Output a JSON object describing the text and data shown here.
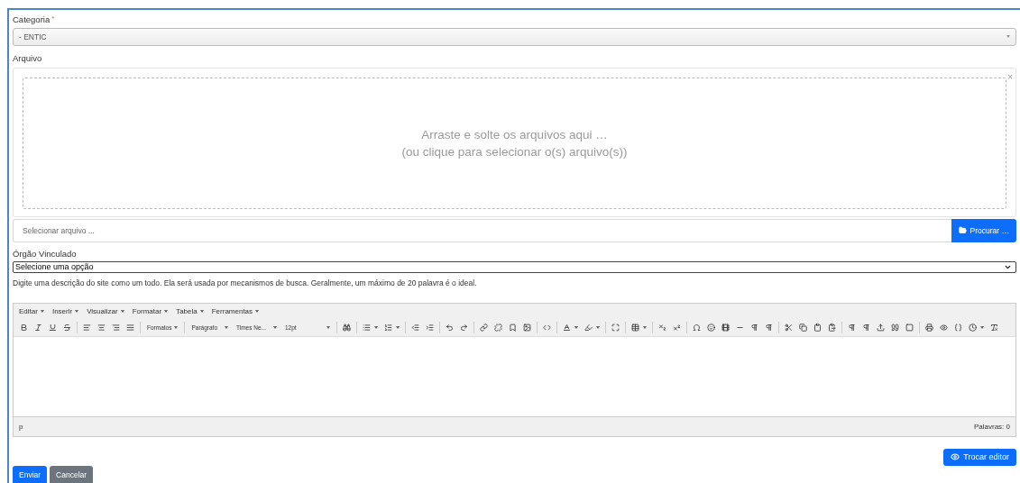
{
  "category": {
    "label": "Categoria",
    "required_mark": "*",
    "value": "- ENTIC"
  },
  "file": {
    "label": "Arquivo",
    "drop_line_1": "Arraste e solte os arquivos aqui …",
    "drop_line_2": "(ou clique para selecionar o(s) arquivo(s))",
    "close": "×",
    "placeholder": "Selecionar arquivo ...",
    "browse_button": "Procurar …"
  },
  "organ": {
    "label": "Órgão Vinculado",
    "value": "Selecione uma opção"
  },
  "description_hint": "Digite uma descrição do site como um todo. Ela será usada por mecanismos de busca. Geralmente, um máximo de 20 palavra é o ideal.",
  "editor": {
    "menus": [
      "Editar",
      "Inserir",
      "Visualizar",
      "Formatar",
      "Tabela",
      "Ferramentas"
    ],
    "dropdowns": [
      "Formatos",
      "Parágrafo",
      "Times Ne...",
      "12pt"
    ],
    "path": "p",
    "word_count": "Palavras: 0"
  },
  "switch_editor_button": "Trocar editor",
  "buttons": [
    {
      "label": "Enviar",
      "kind": "primary"
    },
    {
      "label": "Cancelar",
      "kind": "secondary"
    }
  ]
}
